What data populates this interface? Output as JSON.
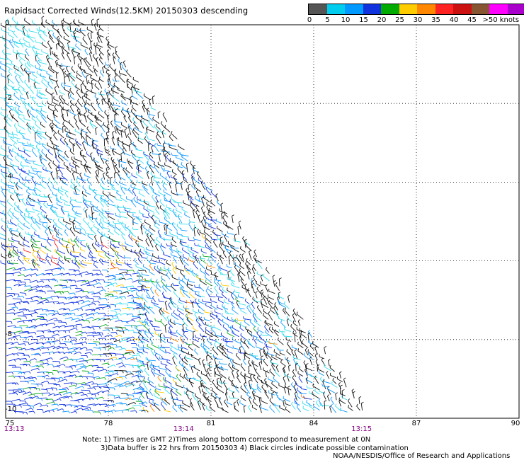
{
  "title": "Rapidsact Corrected Winds(12.5KM) 20150303 descending",
  "legend": {
    "colors": [
      "#555555",
      "#00ccee",
      "#0099ff",
      "#1133dd",
      "#00aa00",
      "#ffcc00",
      "#ff8800",
      "#ff2222",
      "#cc1111",
      "#885533",
      "#ff00ff",
      "#aa00cc",
      "#660099"
    ],
    "labels": [
      {
        "text": "0",
        "at": 0
      },
      {
        "text": "5",
        "at": 1
      },
      {
        "text": "10",
        "at": 2
      },
      {
        "text": "15",
        "at": 3
      },
      {
        "text": "20",
        "at": 4
      },
      {
        "text": "25",
        "at": 5
      },
      {
        "text": "30",
        "at": 6
      },
      {
        "text": "35",
        "at": 7
      },
      {
        "text": "40",
        "at": 8
      },
      {
        "text": "45",
        "at": 9
      },
      {
        "text": ">50 knots",
        "at": 10.6
      }
    ]
  },
  "map": {
    "lon_ticks": [
      "75",
      "78",
      "81",
      "84",
      "87",
      "90"
    ],
    "lat_ticks": [
      "0",
      "-2",
      "-4",
      "-6",
      "-8",
      "-10"
    ],
    "lon_range": [
      75,
      90
    ],
    "lat_range": [
      0,
      -10
    ],
    "grid": "dotted",
    "swath_color_classes": [
      "black",
      "cyan",
      "light-blue",
      "blue",
      "green",
      "yellow",
      "orange",
      "red"
    ],
    "time_labels": [
      {
        "text": "13:13",
        "lon": 75
      },
      {
        "text": "13:14",
        "lon": 80.2
      },
      {
        "text": "13:15",
        "lon": 85.4
      }
    ]
  },
  "notes": {
    "line1": "Note: 1) Times are GMT 2)Times along bottom correspond to measurement at 0N",
    "line2": "3)Data buffer is 22 hrs from 20150303 4) Black circles indicate possible contamination",
    "line3": "NOAA/NESDIS/Office of Research and Applications"
  }
}
